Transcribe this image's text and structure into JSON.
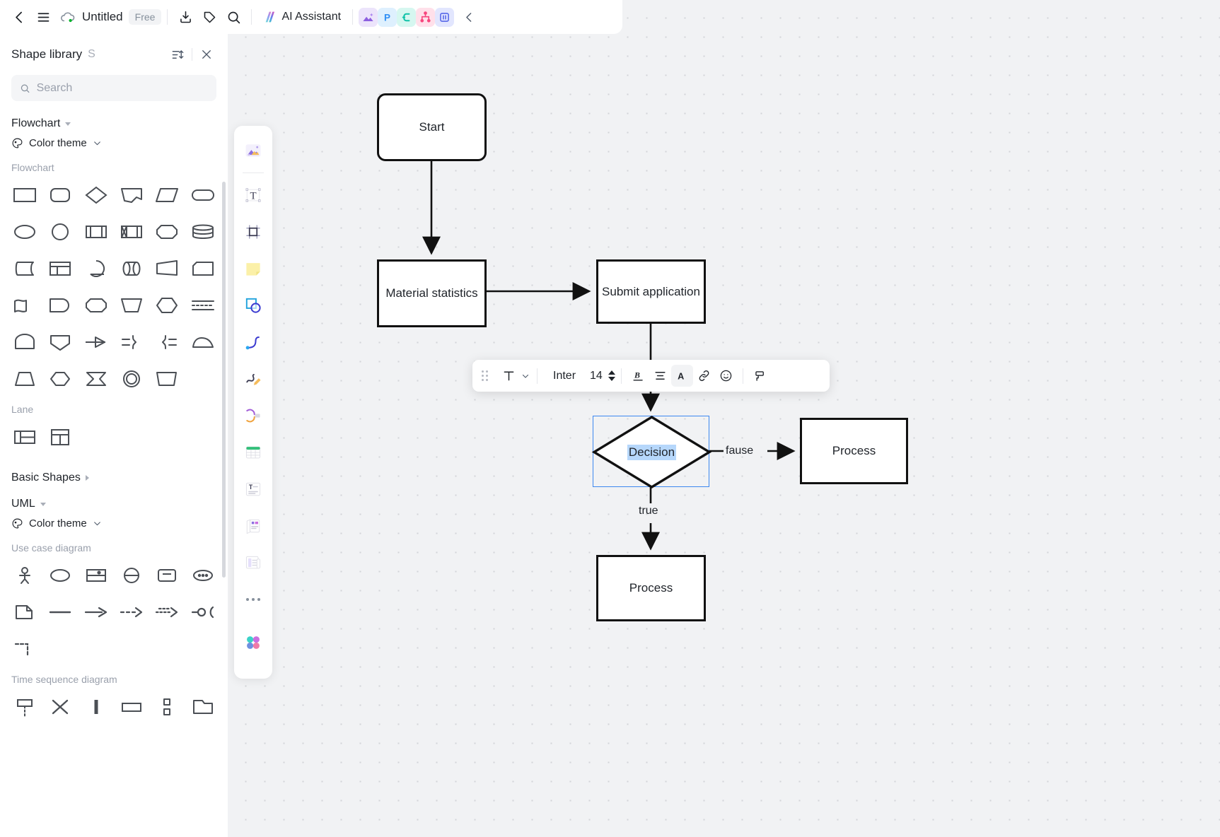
{
  "topbar": {
    "back_icon": "chevron-left-icon",
    "menu_icon": "hamburger-menu-icon",
    "cloud_icon": "cloud-saved-icon",
    "doc_title": "Untitled",
    "plan_badge": "Free",
    "export_icon": "export-download-icon",
    "tag_icon": "tag-icon",
    "search_icon": "search-icon",
    "ai_label": "AI Assistant",
    "app_icons": [
      "image-app-icon",
      "presentation-app-icon",
      "mindmap-app-icon",
      "flowchart-app-icon",
      "board-app-icon"
    ],
    "collapse_icon": "chevron-left-collapse-icon"
  },
  "shape_library": {
    "title": "Shape library",
    "shortcut": "S",
    "sort_icon": "sort-list-icon",
    "close_icon": "close-icon",
    "search": {
      "placeholder": "Search",
      "value": "",
      "icon": "search-icon"
    },
    "sections": [
      {
        "name": "Flowchart",
        "expanded": true,
        "color_theme_label": "Color theme",
        "color_theme_icon": "palette-icon",
        "groups": [
          {
            "label": "Flowchart",
            "shapes": [
              "rectangle",
              "rounded-rectangle",
              "diamond",
              "document",
              "parallelogram",
              "stadium",
              "ellipse",
              "circle",
              "predefined-process",
              "internal-storage",
              "octagon",
              "database",
              "stored-data",
              "window-card",
              "display-round",
              "direct-access-storage",
              "trapezoid-right",
              "card-cut",
              "wave-document",
              "delay",
              "hexagon-round",
              "manual-operation",
              "hexagon",
              "dashed-lines",
              "bump-top",
              "shield-pentagon",
              "arrow-flag",
              "merge-brace-right",
              "merge-brace-left",
              "cloud-flat",
              "trapezoid",
              "hexagon-plain",
              "sum-junction-flag",
              "donut-circle",
              "skew-parallelogram"
            ]
          },
          {
            "label": "Lane",
            "shapes": [
              "horizontal-lane",
              "vertical-lane"
            ]
          }
        ]
      },
      {
        "name": "Basic Shapes",
        "expanded": false,
        "groups": []
      },
      {
        "name": "UML",
        "expanded": true,
        "color_theme_label": "Color theme",
        "color_theme_icon": "palette-icon",
        "groups": [
          {
            "label": "Use case diagram",
            "shapes": [
              "actor-stick-figure",
              "use-case-ellipse",
              "boundary-box",
              "control-circle",
              "entity-rect",
              "note-ellipsis",
              "note-document",
              "solid-line",
              "solid-arrow",
              "dashed-arrow",
              "dotted-arrow",
              "ball-socket",
              "dashed-corner"
            ]
          },
          {
            "label": "Time sequence diagram",
            "shapes": [
              "lifeline",
              "destroy-x",
              "activation-bar",
              "message-rect",
              "fragment-split",
              "frame-box"
            ]
          }
        ]
      }
    ]
  },
  "tool_dock": {
    "items": [
      "image-tool-icon",
      "text-tool-icon",
      "frame-tool-icon",
      "sticky-note-tool-icon",
      "shape-tool-icon",
      "connector-tool-icon",
      "pen-tool-icon",
      "highlighter-tool-icon",
      "table-tool-icon",
      "text-block-tool-icon",
      "template-tool-icon",
      "card-tool-icon",
      "more-tools-icon",
      "apps-tool-icon"
    ]
  },
  "format_toolbar": {
    "grip_icon": "drag-grip-icon",
    "text_style_icon": "text-style-icon",
    "text_style_caret": "chevron-down-icon",
    "font_family": "Inter",
    "font_size": "14",
    "stepper_up_icon": "stepper-up-icon",
    "stepper_down_icon": "stepper-down-icon",
    "bold_italic_icon": "bold-italic-icon",
    "align_icon": "align-center-icon",
    "font_color_icon": "font-color-icon",
    "link_icon": "link-icon",
    "emoji_icon": "emoji-icon",
    "format_painter_icon": "format-painter-icon"
  },
  "diagram": {
    "nodes": [
      {
        "id": "start",
        "label": "Start"
      },
      {
        "id": "material",
        "label": "Material statistics"
      },
      {
        "id": "submit",
        "label": "Submit application"
      },
      {
        "id": "decision",
        "label": "Decision",
        "selected": true,
        "text_highlighted": true
      },
      {
        "id": "process_right",
        "label": "Process"
      },
      {
        "id": "process_bottom",
        "label": "Process"
      }
    ],
    "edge_labels": {
      "fause": "fause",
      "true": "true"
    },
    "selection_color": "#3c87f0",
    "text_highlight_color": "#b6d7fb",
    "stroke_color": "#111111"
  }
}
